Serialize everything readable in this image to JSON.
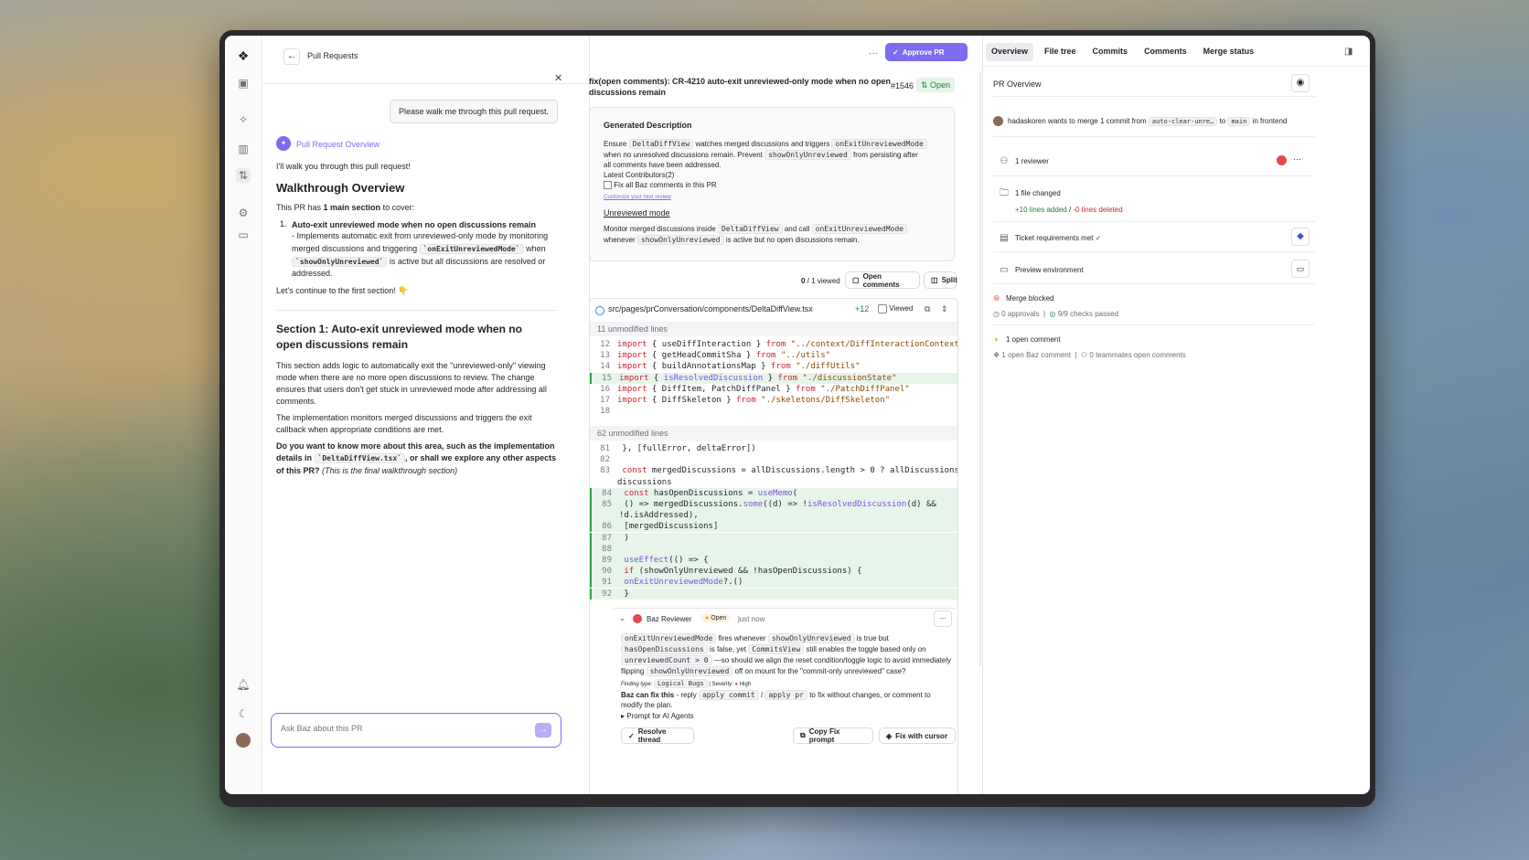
{
  "nav": {
    "back_label": "Pull Requests"
  },
  "chat": {
    "user_message": "Please walk me through this pull request.",
    "assistant_name": "Pull Request Overview",
    "intro": "I'll walk you through this pull request!",
    "walkthrough_title": "Walkthrough Overview",
    "covers_pre": "This PR has ",
    "covers_bold": "1 main section",
    "covers_post": " to cover:",
    "item_num": "1.",
    "item_title": "Auto-exit unreviewed mode when no open discussions remain",
    "item_l1": " - Implements automatic exit from unreviewed-only mode by monitoring",
    "item_l2": "merged discussions and triggering",
    "item_code1": "`onExitUnreviewedMode`",
    "item_l2b": "when",
    "item_code2": "`showOnlyUnreviewed`",
    "item_l3": "is active but all discussions are resolved or",
    "item_l4": "addressed.",
    "continue": "Let's continue to the first section! 👇",
    "section_title_l1": "Section 1: Auto-exit unreviewed mode when no",
    "section_title_l2": "open discussions remain",
    "p1": [
      "This section adds logic to automatically exit the \"unreviewed-only\" viewing",
      "mode when there are no more open discussions to review. The change",
      "ensures that users don't get stuck in unreviewed mode after addressing all",
      "comments."
    ],
    "p2": [
      "The implementation monitors merged discussions and triggers the exit",
      "callback when appropriate conditions are met."
    ],
    "q1": "Do you want to know more about this area, such as the implementation",
    "q2a": "details in",
    "q2code": "`DeltaDiffView.tsx`",
    "q2b": ", or shall we explore any other aspects",
    "q3a": "of this PR?",
    "q3b": "(This is the final walkthrough section)",
    "input_placeholder": "Ask Baz about this PR"
  },
  "pr": {
    "title_l1": "fix(open comments): CR-4210 auto-exit unreviewed-only mode when no open",
    "title_l2": "discussions remain",
    "number": "#1546",
    "status": "Open",
    "approve_label": "Approve PR",
    "more": "···"
  },
  "description": {
    "heading": "Generated Description",
    "l1a": "Ensure",
    "l1c1": "DeltaDiffView",
    "l1b": "watches merged discussions and triggers",
    "l1c2": "onExitUnreviewedMode",
    "l2a": "when no unresolved discussions remain. Prevent",
    "l2c": "showOnlyUnreviewed",
    "l2b": "from persisting after",
    "l3": "all comments have been addressed.",
    "contributors": "Latest Contributors(2)",
    "checkbox_label": "Fix all Baz comments in this PR",
    "customize": "Customize your next review",
    "subheading": "Unreviewed mode",
    "m1a": "Monitor merged discussions inside",
    "m1c1": "DeltaDiffView",
    "m1b": "and call",
    "m1c2": "onExitUnreviewedMode",
    "m2a": "whenever",
    "m2c": "showOnlyUnreviewed",
    "m2b": "is active but no open discussions remain."
  },
  "diff_toolbar": {
    "viewed_count": "0",
    "viewed_total": " / 1",
    "viewed_label": "viewed",
    "open_comments": "Open comments",
    "split": "Split"
  },
  "file": {
    "path": "src/pages/prConversation/components/DeltaDiffView.tsx",
    "additions": "+12",
    "viewed_label": "Viewed",
    "unmodified_1": "11 unmodified lines",
    "unmodified_2": "62 unmodified lines",
    "lines_a": [
      {
        "n": "12",
        "code": "import { useDiffInteraction } from \"../context/DiffInteractionContext\""
      },
      {
        "n": "13",
        "code": "import { getHeadCommitSha } from \"../utils\""
      },
      {
        "n": "14",
        "code": "import { buildAnnotationsMap } from \"./diffUtils\""
      },
      {
        "n": "15",
        "code": "import { isResolvedDiscussion } from \"./discussionState\""
      },
      {
        "n": "16",
        "code": "import { DiffItem, PatchDiffPanel } from \"./PatchDiffPanel\""
      },
      {
        "n": "17",
        "code": "import { DiffSkeleton } from \"./skeletons/DiffSkeleton\""
      },
      {
        "n": "18",
        "code": ""
      }
    ],
    "lines_b": [
      {
        "n": "81",
        "code": "  }, [fullError, deltaError])"
      },
      {
        "n": "82",
        "code": ""
      },
      {
        "n": "83",
        "code": "  const mergedDiscussions = allDiscussions.length > 0 ? allDiscussions :"
      },
      {
        "n": "",
        "code": "discussions"
      },
      {
        "n": "84",
        "code": "  const hasOpenDiscussions = useMemo("
      },
      {
        "n": "85",
        "code": "    () => mergedDiscussions.some((d) => !isResolvedDiscussion(d) &&"
      },
      {
        "n": "",
        "code": "!d.isAddressed),"
      },
      {
        "n": "86",
        "code": "    [mergedDiscussions]"
      },
      {
        "n": "87",
        "code": "  )"
      },
      {
        "n": "88",
        "code": ""
      },
      {
        "n": "89",
        "code": "  useEffect(() => {"
      },
      {
        "n": "90",
        "code": "    if (showOnlyUnreviewed && !hasOpenDiscussions) {"
      },
      {
        "n": "91",
        "code": "      onExitUnreviewedMode?.()"
      },
      {
        "n": "92",
        "code": "    }"
      }
    ]
  },
  "comment": {
    "author": "Baz Reviewer",
    "status": "Open",
    "time": "just now",
    "c1": "onExitUnreviewedMode",
    "t1": "fires whenever",
    "c2": "showOnlyUnreviewed",
    "t2": "is true but",
    "c3": "hasOpenDiscussions",
    "t3": "is false, yet",
    "c4": "CommitsView",
    "t4": "still enables the toggle based only on",
    "c5": "unreviewedCount > 0",
    "t5": "—so should we align the reset condition/toggle logic to avoid immediately",
    "t6": "flipping",
    "c6": "showOnlyUnreviewed",
    "t7": "off on mount for the \"commit-only unreviewed\" case?",
    "finding_label": "Finding type:",
    "finding_value": "Logical Bugs",
    "severity_label": "| Severity:",
    "severity_value": "High",
    "fix_bold": "Baz can fix this",
    "fix_a": " - reply",
    "fix_c1": "apply commit",
    "fix_slash": "/",
    "fix_c2": "apply pr",
    "fix_b": "to fix without changes, or comment to",
    "fix_c": "modify the plan.",
    "prompt": "▸ Prompt for AI Agents",
    "resolve": "Resolve thread",
    "copy_fix": "Copy Fix prompt",
    "fix_cursor": "Fix with cursor"
  },
  "tabs": [
    "Overview",
    "File tree",
    "Commits",
    "Comments",
    "Merge status"
  ],
  "overview": {
    "title": "PR Overview",
    "merge_user": "hadaskoren",
    "merge_text": "wants to merge 1 commit from",
    "source_branch": "auto-clear-unre…",
    "to": "to",
    "target_branch": "main",
    "in": "in",
    "repo": "frontend",
    "reviewers": "1 reviewer",
    "files_changed": "1 file changed",
    "lines_added": "+10 lines added",
    "lines_sep": " / ",
    "lines_deleted": "-0 lines deleted",
    "ticket": "Ticket requirements met",
    "preview": "Preview environment",
    "merge_blocked": "Merge blocked",
    "approvals": "0 approvals",
    "checks": "9/9 checks passed",
    "open_comment": "1 open comment",
    "baz_comment": "1 open Baz comment",
    "teammates": "0 teammates open comments"
  },
  "colors": {
    "accent": "#7c6cf0",
    "green": "#1a7f37",
    "red": "#cf222e",
    "added_bg": "#e6f4ea"
  }
}
